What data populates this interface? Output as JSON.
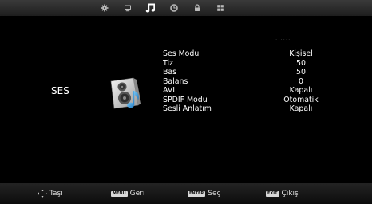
{
  "top_tabs": [
    {
      "name": "tab-settings",
      "icon": "gear-icon",
      "active": false
    },
    {
      "name": "tab-picture",
      "icon": "monitor-icon",
      "active": false
    },
    {
      "name": "tab-sound",
      "icon": "music-note-icon",
      "active": true
    },
    {
      "name": "tab-timer",
      "icon": "clock-icon",
      "active": false
    },
    {
      "name": "tab-lock",
      "icon": "lock-icon",
      "active": false
    },
    {
      "name": "tab-setup",
      "icon": "grid-icon",
      "active": false
    }
  ],
  "section": {
    "title": "SES",
    "icon": "speaker-music-icon"
  },
  "menu": {
    "more_indicator": "······",
    "items": [
      {
        "label": "Ses Modu",
        "value": "Kişisel"
      },
      {
        "label": "Tiz",
        "value": "50"
      },
      {
        "label": "Bas",
        "value": "50"
      },
      {
        "label": "Balans",
        "value": "0"
      },
      {
        "label": "AVL",
        "value": "Kapalı"
      },
      {
        "label": "SPDIF Modu",
        "value": "Otomatik"
      },
      {
        "label": "Sesli Anlatım",
        "value": "Kapalı"
      }
    ]
  },
  "footer": {
    "move": {
      "icon": "dpad-arrows-icon",
      "label": "Taşı"
    },
    "back": {
      "key": "MENU",
      "label": "Geri"
    },
    "select": {
      "key": "ENTER",
      "label": "Seç"
    },
    "exit": {
      "key": "EXIT",
      "label": "Çıkış"
    }
  },
  "colors": {
    "background": "#000000",
    "bar": "#2a2a2a",
    "icon_inactive": "#bbbbbb",
    "icon_active": "#ffffff",
    "speaker_accent": "#3aa0e0"
  }
}
